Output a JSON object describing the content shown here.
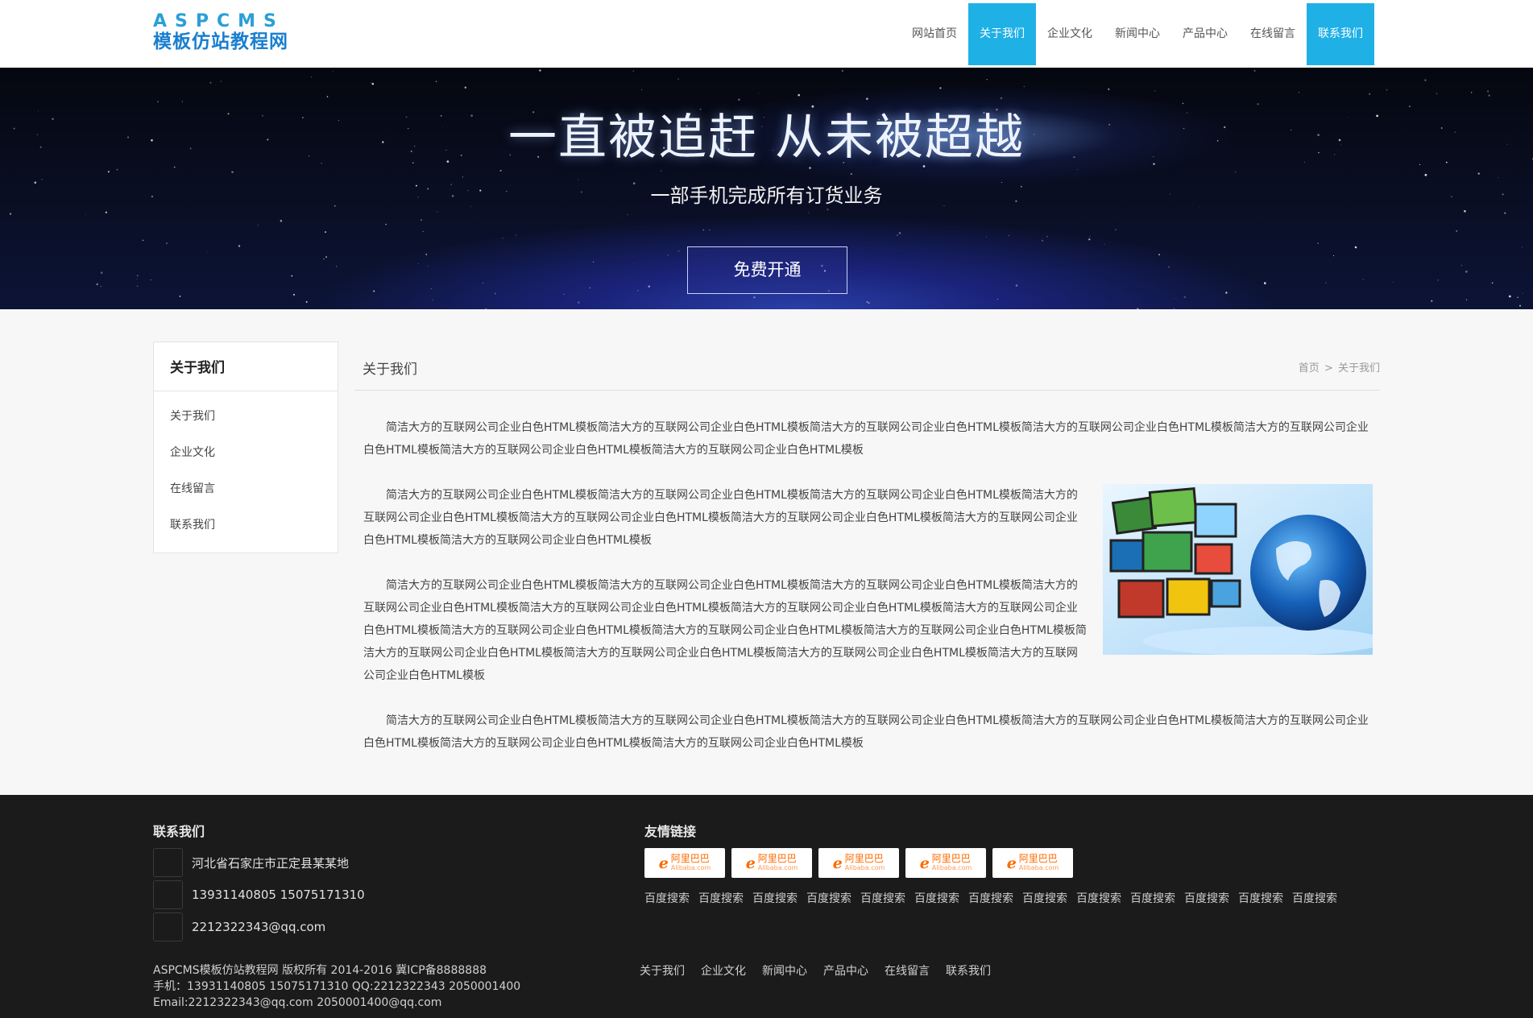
{
  "logo": {
    "top": "ASPCMS",
    "bottom": "模板仿站教程网"
  },
  "nav": {
    "items": [
      {
        "label": "网站首页"
      },
      {
        "label": "关于我们",
        "active": true
      },
      {
        "label": "企业文化"
      },
      {
        "label": "新闻中心"
      },
      {
        "label": "产品中心"
      },
      {
        "label": "在线留言"
      },
      {
        "label": "联系我们",
        "active": true
      }
    ]
  },
  "banner": {
    "title": "一直被追赶 从未被超越",
    "subtitle": "一部手机完成所有订货业务",
    "button_label": "免费开通"
  },
  "sidebar": {
    "title": "关于我们",
    "items": [
      {
        "label": "关于我们"
      },
      {
        "label": "企业文化"
      },
      {
        "label": "在线留言"
      },
      {
        "label": "联系我们"
      }
    ]
  },
  "main": {
    "title": "关于我们",
    "breadcrumb": {
      "home": "首页",
      "sep": ">",
      "current": "关于我们"
    },
    "paragraphs": [
      "简洁大方的互联网公司企业白色HTML模板简洁大方的互联网公司企业白色HTML模板简洁大方的互联网公司企业白色HTML模板简洁大方的互联网公司企业白色HTML模板简洁大方的互联网公司企业白色HTML模板简洁大方的互联网公司企业白色HTML模板简洁大方的互联网公司企业白色HTML模板",
      "简洁大方的互联网公司企业白色HTML模板简洁大方的互联网公司企业白色HTML模板简洁大方的互联网公司企业白色HTML模板简洁大方的互联网公司企业白色HTML模板简洁大方的互联网公司企业白色HTML模板简洁大方的互联网公司企业白色HTML模板简洁大方的互联网公司企业白色HTML模板简洁大方的互联网公司企业白色HTML模板",
      "简洁大方的互联网公司企业白色HTML模板简洁大方的互联网公司企业白色HTML模板简洁大方的互联网公司企业白色HTML模板简洁大方的互联网公司企业白色HTML模板简洁大方的互联网公司企业白色HTML模板简洁大方的互联网公司企业白色HTML模板简洁大方的互联网公司企业白色HTML模板简洁大方的互联网公司企业白色HTML模板简洁大方的互联网公司企业白色HTML模板简洁大方的互联网公司企业白色HTML模板简洁大方的互联网公司企业白色HTML模板简洁大方的互联网公司企业白色HTML模板简洁大方的互联网公司企业白色HTML模板简洁大方的互联网公司企业白色HTML模板",
      "简洁大方的互联网公司企业白色HTML模板简洁大方的互联网公司企业白色HTML模板简洁大方的互联网公司企业白色HTML模板简洁大方的互联网公司企业白色HTML模板简洁大方的互联网公司企业白色HTML模板简洁大方的互联网公司企业白色HTML模板简洁大方的互联网公司企业白色HTML模板"
    ]
  },
  "footer": {
    "contact_heading": "联系我们",
    "contacts": [
      {
        "icon": "location-icon",
        "text": "河北省石家庄市正定县某某地"
      },
      {
        "icon": "phone-icon",
        "text": "13931140805 15075171310"
      },
      {
        "icon": "email-icon",
        "text": "2212322343@qq.com"
      }
    ],
    "links_heading": "友情链接",
    "link_logos": [
      {
        "cn": "阿里巴巴",
        "en": "Alibaba.com"
      },
      {
        "cn": "阿里巴巴",
        "en": "Alibaba.com"
      },
      {
        "cn": "阿里巴巴",
        "en": "Alibaba.com"
      },
      {
        "cn": "阿里巴巴",
        "en": "Alibaba.com"
      },
      {
        "cn": "阿里巴巴",
        "en": "Alibaba.com"
      }
    ],
    "text_links": [
      "百度搜索",
      "百度搜索",
      "百度搜索",
      "百度搜索",
      "百度搜索",
      "百度搜索",
      "百度搜索",
      "百度搜索",
      "百度搜索",
      "百度搜索",
      "百度搜索",
      "百度搜索",
      "百度搜索"
    ],
    "copyright": [
      "ASPCMS模板仿站教程网 版权所有 2014-2016 冀ICP备8888888",
      "手机：13931140805 15075171310 QQ:2212322343 2050001400",
      "Email:2212322343@qq.com 2050001400@qq.com"
    ],
    "bottom_nav": [
      "关于我们",
      "企业文化",
      "新闻中心",
      "产品中心",
      "在线留言",
      "联系我们"
    ]
  },
  "colors": {
    "accent": "#1fb0e6",
    "footer_bg": "#1b1b1b"
  }
}
